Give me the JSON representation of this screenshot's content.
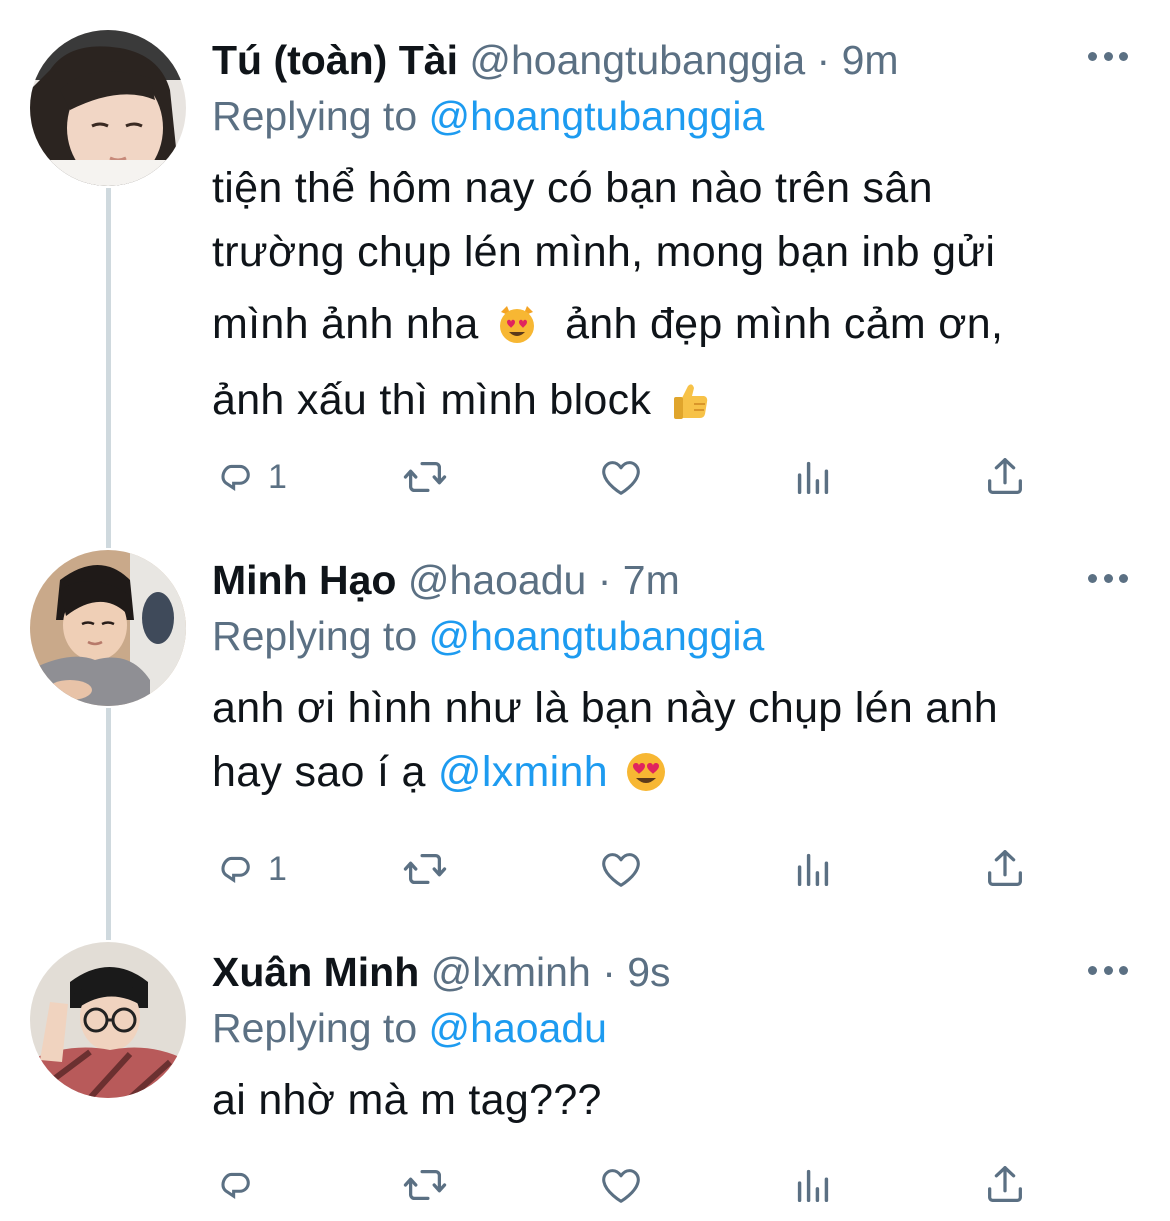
{
  "colors": {
    "text": "#0f1419",
    "secondary": "#5b7083",
    "link": "#1d9bf0",
    "thread_line": "#cfd9de"
  },
  "tweets": [
    {
      "name": "Tú (toàn) Tài",
      "handle": "@hoangtubanggia",
      "separator": "·",
      "time": "9m",
      "reply_prefix": "Replying to",
      "reply_to": "@hoangtubanggia",
      "lines": [
        "tiện thể hôm nay có bạn nào trên sân",
        "trường chụp lén mình, mong bạn inb gửi",
        "mình ảnh nha",
        "ảnh đẹp mình cảm ơn,",
        "ảnh xấu thì mình block"
      ],
      "emojis": [
        "heart-eyes-cat-emoji",
        "thumbs-up-emoji"
      ],
      "reply_count": "1",
      "icons": [
        "reply-icon",
        "retweet-icon",
        "like-icon",
        "analytics-icon",
        "share-icon",
        "more-options-icon"
      ]
    },
    {
      "name": "Minh Hạo",
      "handle": "@haoadu",
      "separator": "·",
      "time": "7m",
      "reply_prefix": "Replying to",
      "reply_to": "@hoangtubanggia",
      "lines": [
        "anh ơi hình như là bạn này chụp lén anh",
        "hay sao í ạ"
      ],
      "mention": "@lxminh",
      "emojis": [
        "heart-eyes-emoji"
      ],
      "reply_count": "1"
    },
    {
      "name": "Xuân Minh",
      "handle": "@lxminh",
      "separator": "·",
      "time": "9s",
      "reply_prefix": "Replying to",
      "reply_to": "@haoadu",
      "lines": [
        "ai nhờ mà m tag???"
      ],
      "reply_count": ""
    }
  ]
}
